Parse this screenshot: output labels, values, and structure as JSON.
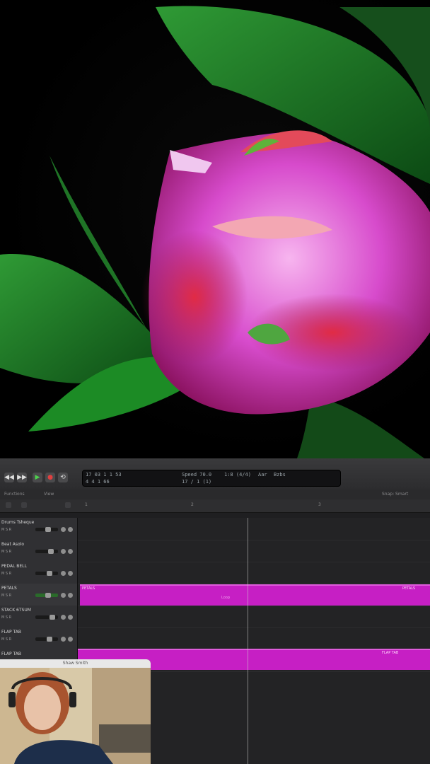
{
  "transport": {
    "lcd_position": "17 03 1 1 53",
    "lcd_beats": "4  4  1  66",
    "lcd_tempo": "Speed 70.0",
    "lcd_meter": "1:8 (4/4)",
    "lcd_key": "Aar",
    "lcd_extra": "Bzbs",
    "lcd_sub": "17 / 1 (1)"
  },
  "toolbar": {
    "item1": "Functions",
    "item2": "View",
    "item3": "Snap: Smart"
  },
  "ruler": {
    "ticks": [
      "1",
      "2",
      "3"
    ]
  },
  "tracks": [
    {
      "name": "Drums Tsheque"
    },
    {
      "name": "Beat Asolo"
    },
    {
      "name": "PEDAL BELL"
    },
    {
      "name": "PETALS"
    },
    {
      "name": "STACK 6TSUM"
    },
    {
      "name": "FLAP TAB"
    },
    {
      "name": "FLAP TAB"
    }
  ],
  "regions": [
    {
      "left_label": "PETALS",
      "right_label": "PETALS",
      "mid_label": "Loop"
    },
    {
      "left_label": "",
      "right_label": "FLAP TAB",
      "mid_label": ""
    }
  ],
  "webcam": {
    "name": "Shaw Smith"
  },
  "colors": {
    "region": "#c61fc4",
    "petal": "#d53fc8",
    "leaf": "#1d7a22"
  }
}
